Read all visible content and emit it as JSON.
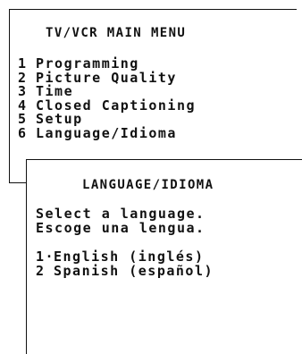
{
  "main_menu": {
    "title": "TV/VCR MAIN MENU",
    "items": [
      {
        "num": "1",
        "label": "Programming"
      },
      {
        "num": "2",
        "label": "Picture Quality"
      },
      {
        "num": "3",
        "label": "Time"
      },
      {
        "num": "4",
        "label": "Closed Captioning"
      },
      {
        "num": "5",
        "label": "Setup"
      },
      {
        "num": "6",
        "label": "Language/Idioma"
      }
    ]
  },
  "language_menu": {
    "title": "LANGUAGE/IDIOMA",
    "prompt_en": "Select a language.",
    "prompt_es": "Escoge una lengua.",
    "options": [
      {
        "num": "1·",
        "label": "English (inglés)",
        "selected": true
      },
      {
        "num": "2",
        "label": "Spanish (español)",
        "selected": false
      }
    ]
  }
}
